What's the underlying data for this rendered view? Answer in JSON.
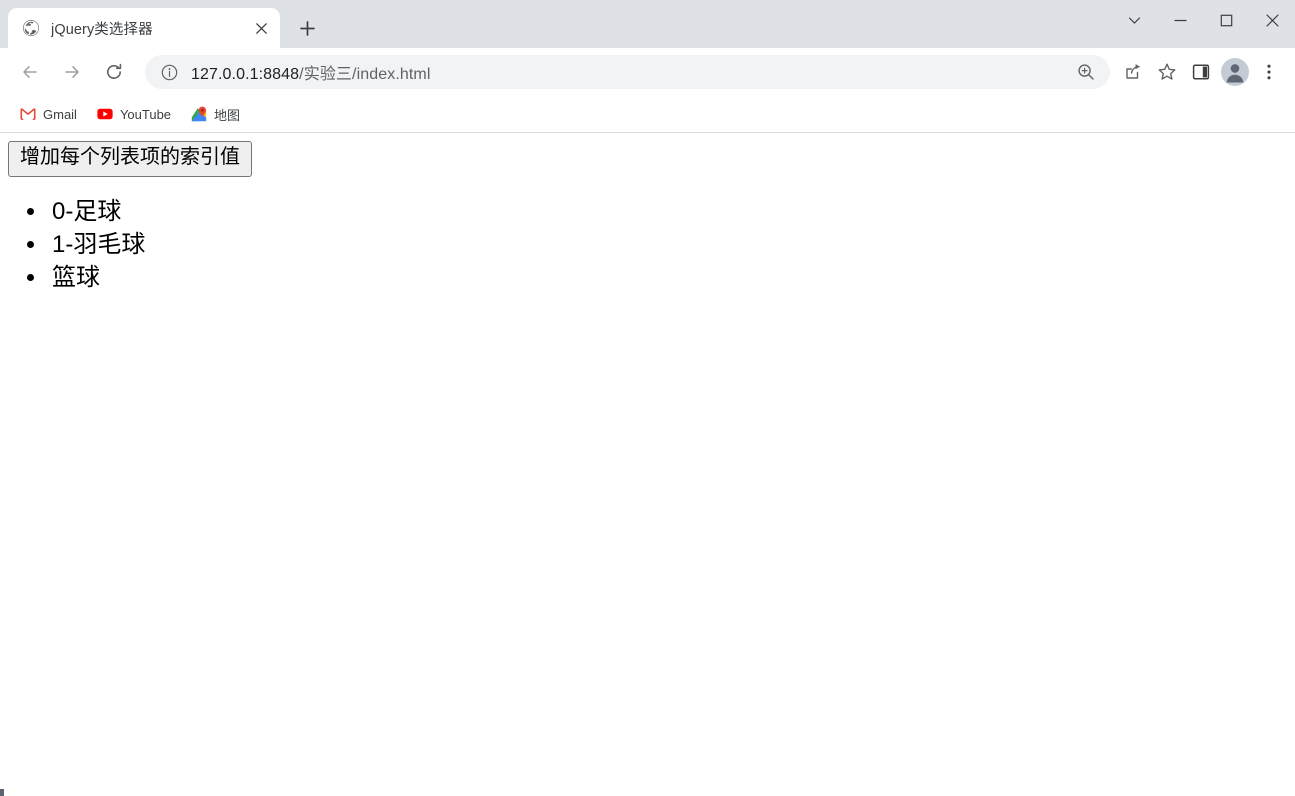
{
  "window": {
    "controls": [
      {
        "name": "tab-search",
        "icon": "chevron-down-icon",
        "label": "Search tabs"
      },
      {
        "name": "minimize",
        "icon": "minimize-icon",
        "label": "Minimize"
      },
      {
        "name": "maximize",
        "icon": "maximize-icon",
        "label": "Maximize"
      },
      {
        "name": "close",
        "icon": "close-icon",
        "label": "Close"
      }
    ]
  },
  "tabstrip": {
    "tab": {
      "title": "jQuery类选择器",
      "favicon": "globe-icon",
      "close_label": "×"
    },
    "new_tab_label": "+"
  },
  "toolbar": {
    "back_label": "←",
    "forward_label": "→",
    "reload_label": "⟳",
    "omnibox": {
      "info_icon": "info-circle-icon",
      "url_host": "127.0.0.1:8848",
      "url_path": "/实验三/index.html",
      "url_full": "127.0.0.1:8848/实验三/index.html",
      "zoom_icon": "zoom-in-icon"
    },
    "share_label": "share-icon",
    "bookmark_label": "star-icon",
    "side_panel_label": "side-panel-icon",
    "profile_label": "profile-avatar",
    "menu_label": "three-dot-menu-icon"
  },
  "bookmarks": [
    {
      "label": "Gmail",
      "icon": "gmail-icon"
    },
    {
      "label": "YouTube",
      "icon": "youtube-icon"
    },
    {
      "label": "地图",
      "icon": "google-maps-icon"
    }
  ],
  "page": {
    "button_label": "增加每个列表项的索引值",
    "list_items": [
      {
        "text": "0-足球"
      },
      {
        "text": "1-羽毛球"
      },
      {
        "text": "篮球"
      }
    ]
  },
  "colors": {
    "chrome_bg": "#dee1e6",
    "tab_bg": "#ffffff",
    "omnibox_bg": "#f1f3f4",
    "page_bg": "#ffffff",
    "text_primary": "#202124",
    "text_secondary": "#5f6368",
    "button_face": "#efefef",
    "button_border": "#767676"
  }
}
